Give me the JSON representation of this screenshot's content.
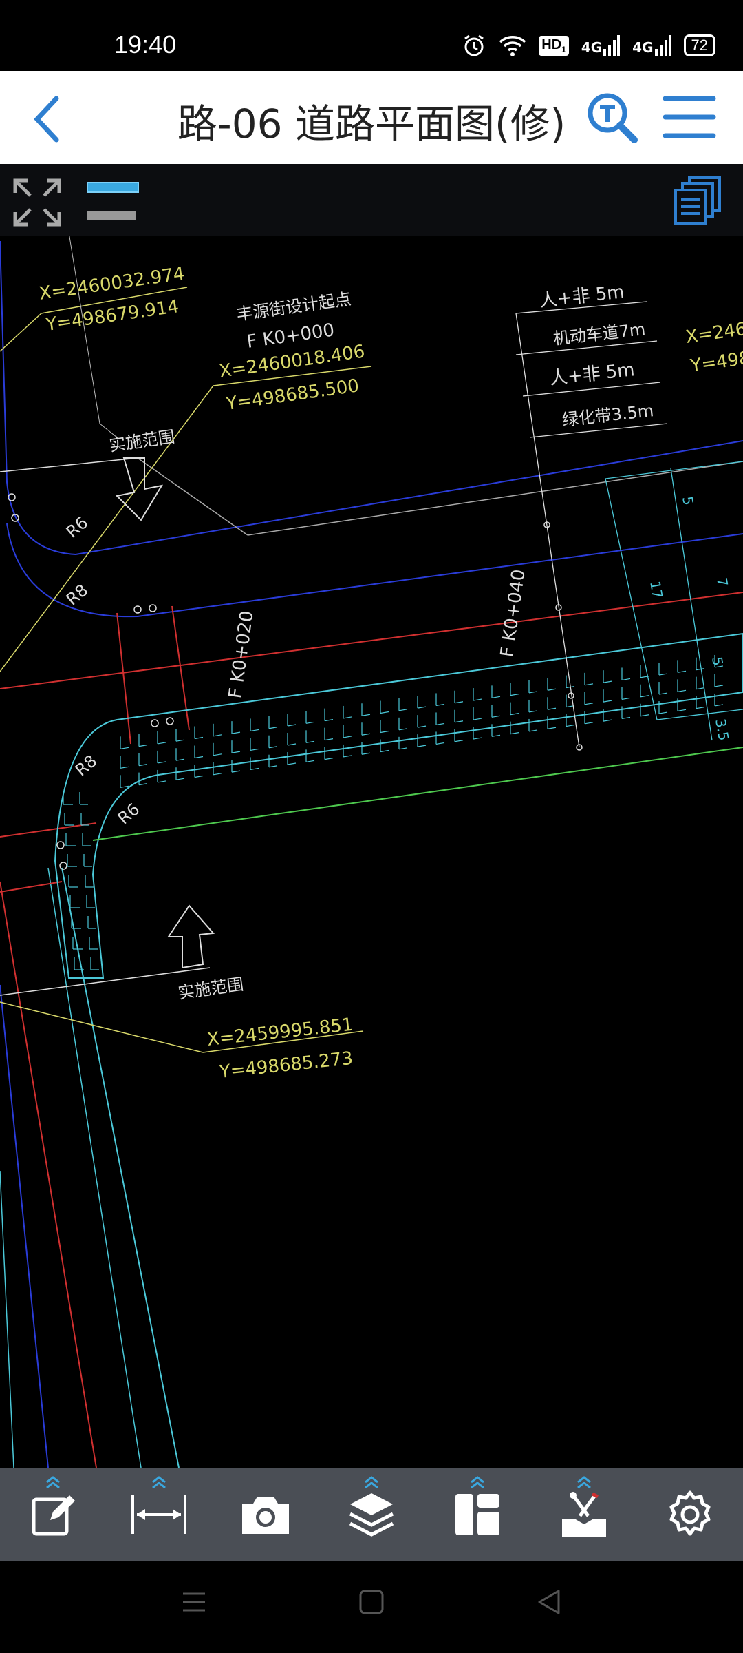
{
  "status": {
    "time": "19:40",
    "hd": "HD",
    "net1": "4G",
    "net2": "4G",
    "battery": "72"
  },
  "header": {
    "title": "路-06 道路平面图(修)"
  },
  "drawing": {
    "coord_top_left_x": "X=2460032.974",
    "coord_top_left_y": "Y=498679.914",
    "start_point": "丰源街设计起点",
    "start_station": "F K0+000",
    "start_x": "X=2460018.406",
    "start_y": "Y=498685.500",
    "impl_range": "实施范围",
    "impl_range_2": "实施范围",
    "r6": "R6",
    "r8": "R8",
    "r8_2": "R8",
    "r6_2": "R6",
    "station_020": "F K0+020",
    "station_040": "F K0+040",
    "sect1": "人+非 5m",
    "sect2": "机动车道7m",
    "sect3": "人+非 5m",
    "sect4": "绿化带3.5m",
    "coord_right_x": "X=246",
    "coord_right_y": "Y=498",
    "dim5": "5",
    "dim17": "17",
    "dim7": "7",
    "dim5b": "5",
    "dim35": "3.5",
    "bottom_x": "X=2459995.851",
    "bottom_y": "Y=498685.273"
  },
  "colors": {
    "accent": "#2f7fd0",
    "toolbar": "#4a4e55",
    "cad_yellow": "#d8d86a",
    "cad_cyan": "#4bc8d8",
    "cad_red": "#d03030",
    "cad_blue": "#2a3cd8",
    "cad_green": "#4ec84e"
  },
  "toolbar_icons": [
    "edit-icon",
    "measure-icon",
    "camera-icon",
    "layers-icon",
    "layout-icon",
    "tools-icon",
    "settings-icon"
  ]
}
